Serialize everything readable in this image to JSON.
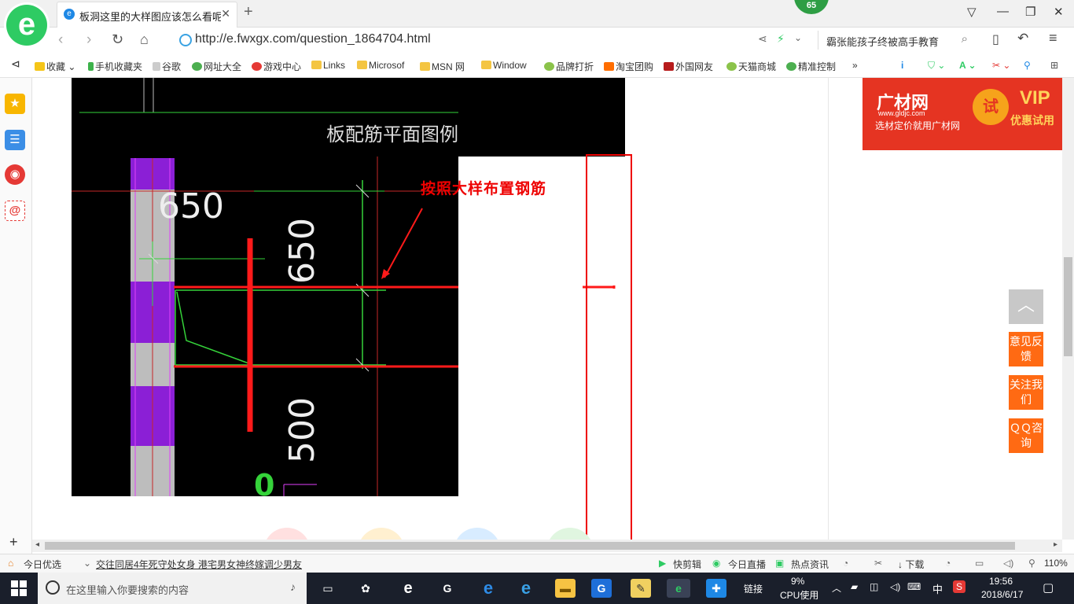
{
  "browser": {
    "tab_title": "板洞这里的大样图应该怎么看呢",
    "new_tab_symbol": "+",
    "badge_count": "65",
    "url": "http://e.fwxgx.com/question_1864704.html",
    "search_query": "霸张能孩子终被高手教育",
    "window_controls": [
      "▽",
      "—",
      "❐",
      "✕"
    ]
  },
  "bookmarks": [
    {
      "label": "收藏",
      "color": "#f5c518"
    },
    {
      "label": "手机收藏夹",
      "color": "#3db24b"
    },
    {
      "label": "谷歌",
      "color": "#999999"
    },
    {
      "label": "网址大全",
      "color": "#4caf50"
    },
    {
      "label": "游戏中心",
      "color": "#e53935"
    },
    {
      "label": "Links",
      "color": "#f4c542"
    },
    {
      "label": "Microsof",
      "color": "#f4c542"
    },
    {
      "label": "MSN 网",
      "color": "#f4c542"
    },
    {
      "label": "Window",
      "color": "#f4c542"
    },
    {
      "label": "品牌打折",
      "color": "#8bc34a"
    },
    {
      "label": "淘宝团购",
      "color": "#ff6d00"
    },
    {
      "label": "外国网友",
      "color": "#b71c1c"
    },
    {
      "label": "天猫商城",
      "color": "#8bc34a"
    },
    {
      "label": "精准控制",
      "color": "#4caf50"
    }
  ],
  "bookmarks_more": "»",
  "drawing": {
    "title": "板配筋平面图例",
    "annotation": "按照大样布置钢筋",
    "dim_650_horizontal": "650",
    "dim_650_vertical": "650",
    "dim_500_vertical": "500",
    "green_digit": "0"
  },
  "ad": {
    "brand": "广材网",
    "site": "www.gldjc.com",
    "slogan": "选材定价就用广材网",
    "trial": "试",
    "vip": "VIP",
    "vip_sub": "优惠试用"
  },
  "float_buttons": {
    "top_arrow": "︿",
    "feedback": "意见反馈",
    "follow": "关注我们",
    "qq": "ＱＱ咨询"
  },
  "status": {
    "today_pick": "今日优选",
    "news": "交往同居4年死守处女身 港宅男女神终嫁调少男友",
    "quick_cut": "快剪辑",
    "live": "今日直播",
    "hot_news": "热点资讯",
    "download": "下载",
    "zoom": "110%"
  },
  "taskbar": {
    "search_placeholder": "在这里输入你要搜索的内容",
    "link_label": "链接",
    "cpu_percent": "9%",
    "cpu_label": "CPU使用",
    "ime": "中",
    "time": "19:56",
    "date": "2018/6/17"
  }
}
